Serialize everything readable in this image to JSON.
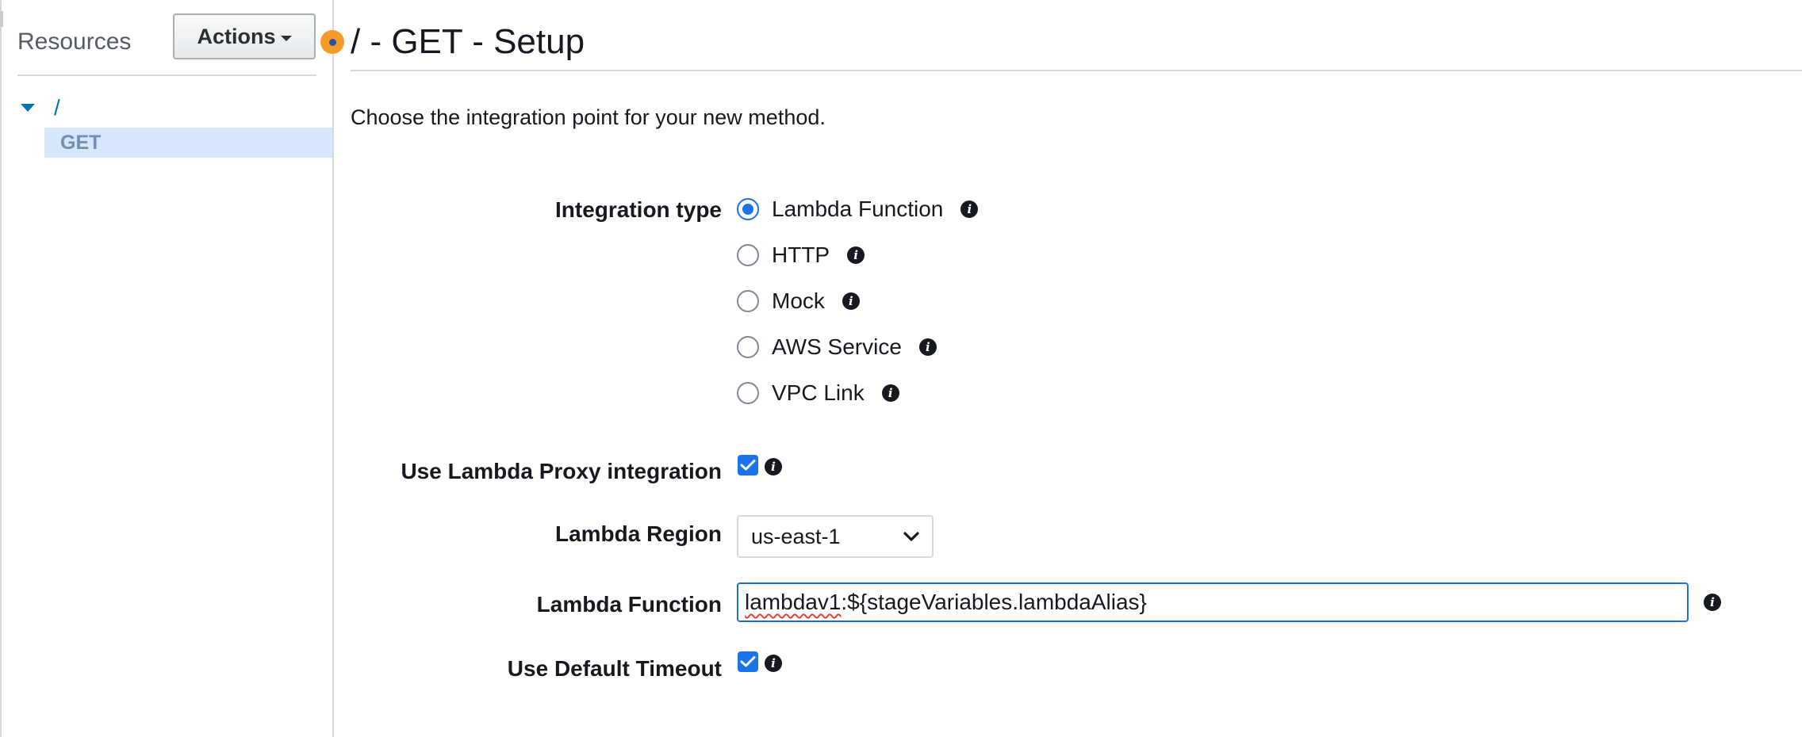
{
  "sidebar": {
    "title": "Resources",
    "actions_label": "Actions",
    "tree": {
      "root_label": "/",
      "method_label": "GET"
    }
  },
  "main": {
    "title": "/ - GET - Setup",
    "subtitle": "Choose the integration point for your new method.",
    "integration_type": {
      "label": "Integration type",
      "selected": "Lambda Function",
      "options": [
        "Lambda Function",
        "HTTP",
        "Mock",
        "AWS Service",
        "VPC Link"
      ]
    },
    "proxy": {
      "label": "Use Lambda Proxy integration",
      "checked": true
    },
    "region": {
      "label": "Lambda Region",
      "value": "us-east-1"
    },
    "function": {
      "label": "Lambda Function",
      "value_part1": "lambdav1",
      "value_part2": ":${stageVariables.lambdaAlias}"
    },
    "timeout": {
      "label": "Use Default Timeout",
      "checked": true
    }
  },
  "colors": {
    "accent": "#1a73e8",
    "link": "#0073bb",
    "handle": "#f59b2a",
    "selected_bg": "#d6e7fb"
  },
  "icons": {
    "info": "info-icon",
    "caret": "caret-down-icon",
    "check": "check-icon"
  }
}
